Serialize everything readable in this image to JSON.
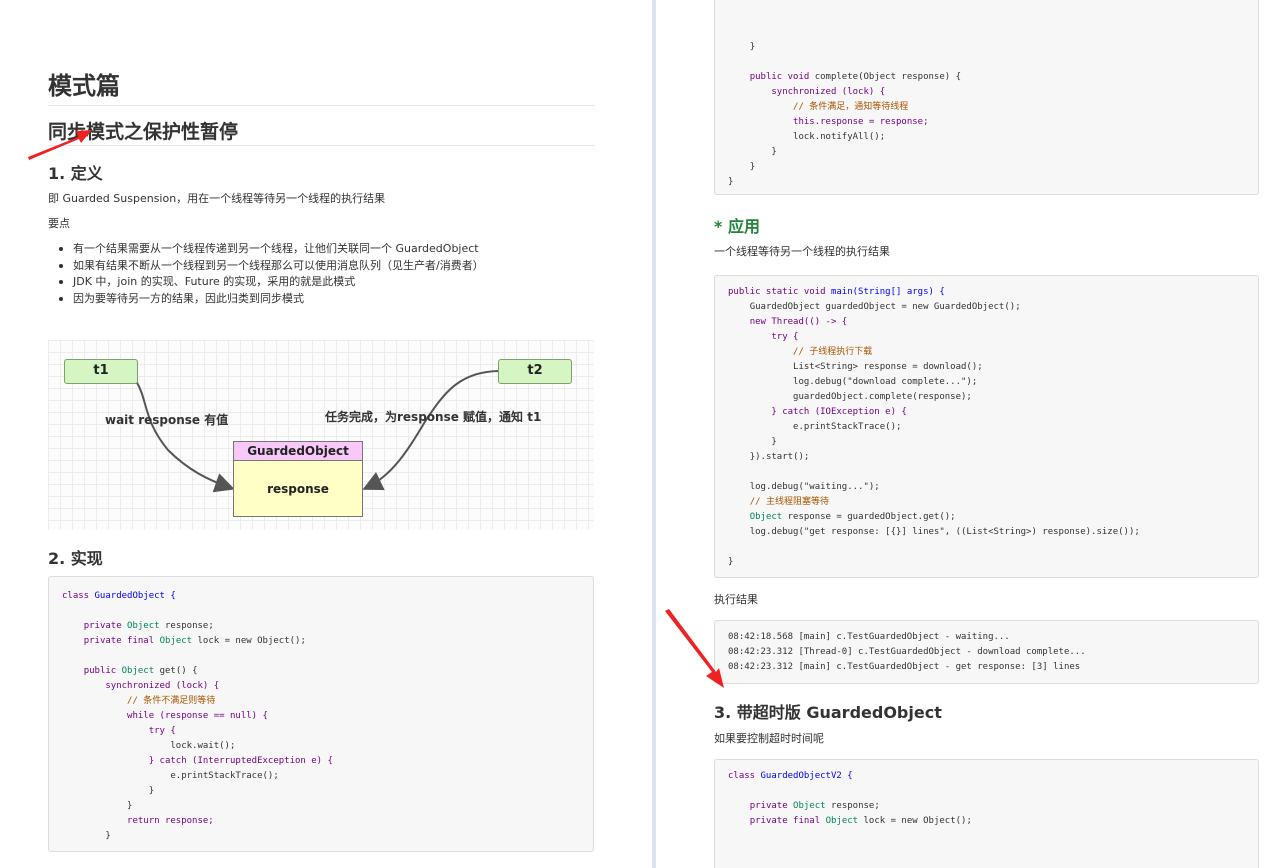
{
  "left": {
    "title": "模式篇",
    "subtitle": "同步模式之保护性暂停",
    "sec1": "1. 定义",
    "def_text": "即 Guarded Suspension，用在一个线程等待另一个线程的执行结果",
    "points_label": "要点",
    "points": [
      "有一个结果需要从一个线程传递到另一个线程，让他们关联同一个 GuardedObject",
      "如果有结果不断从一个线程到另一个线程那么可以使用消息队列（见生产者/消费者）",
      "JDK 中，join 的实现、Future 的实现，采用的就是此模式",
      "因为要等待另一方的结果，因此归类到同步模式"
    ],
    "diagram": {
      "t1": "t1",
      "t2": "t2",
      "guarded_head": "GuardedObject",
      "guarded_body": "response",
      "label_left": "wait response 有值",
      "label_right": "任务完成，为response 赋值，通知 t1"
    },
    "sec2": "2. 实现",
    "code_impl": [
      "class GuardedObject {",
      "",
      "    private Object response;",
      "    private final Object lock = new Object();",
      "",
      "    public Object get() {",
      "        synchronized (lock) {",
      "            // 条件不满足则等待",
      "            while (response == null) {",
      "                try {",
      "                    lock.wait();",
      "                } catch (InterruptedException e) {",
      "                    e.printStackTrace();",
      "                }",
      "            }",
      "            return response;",
      "        }"
    ]
  },
  "right": {
    "code_top": [
      "    }",
      "",
      "    public void complete(Object response) {",
      "        synchronized (lock) {",
      "            // 条件满足，通知等待线程",
      "            this.response = response;",
      "            lock.notifyAll();",
      "        }",
      "    }",
      "}"
    ],
    "sec_apply": "* 应用",
    "apply_text": "一个线程等待另一个线程的执行结果",
    "code_main": [
      "public static void main(String[] args) {",
      "    GuardedObject guardedObject = new GuardedObject();",
      "    new Thread(() -> {",
      "        try {",
      "            // 子线程执行下载",
      "            List<String> response = download();",
      "            log.debug(\"download complete...\");",
      "            guardedObject.complete(response);",
      "        } catch (IOException e) {",
      "            e.printStackTrace();",
      "        }",
      "    }).start();",
      "",
      "    log.debug(\"waiting...\");",
      "    // 主线程阻塞等待",
      "    Object response = guardedObject.get();",
      "    log.debug(\"get response: [{}] lines\", ((List<String>) response).size());",
      "",
      "}"
    ],
    "result_label": "执行结果",
    "output": [
      "08:42:18.568 [main] c.TestGuardedObject - waiting...",
      "08:42:23.312 [Thread-0] c.TestGuardedObject - download complete...",
      "08:42:23.312 [main] c.TestGuardedObject - get response: [3] lines"
    ],
    "sec3": "3. 带超时版 GuardedObject",
    "timeout_text": "如果要控制超时时间呢",
    "code_v2": [
      "class GuardedObjectV2 {",
      "",
      "    private Object response;",
      "    private final Object lock = new Object();"
    ]
  },
  "colors": {
    "heading_green": "#22863a",
    "annotation_arrow": "#ee2222",
    "t_box_fill": "#d5f5c2",
    "guarded_head_fill": "#f8c9f8",
    "guarded_body_fill": "#ffffc6"
  }
}
